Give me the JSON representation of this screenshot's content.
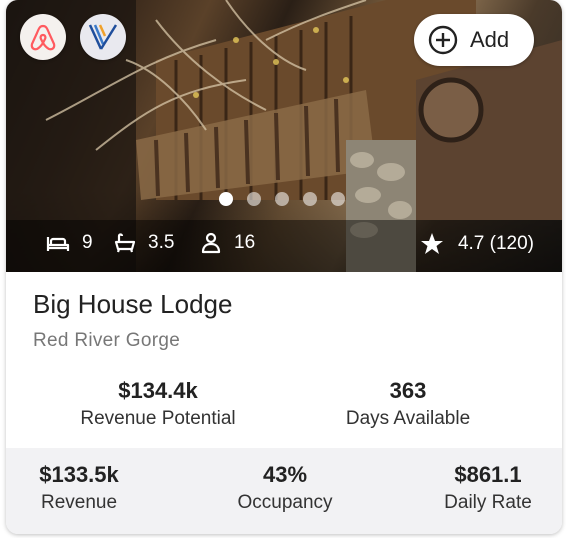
{
  "listing": {
    "title": "Big House Lodge",
    "location": "Red River Gorge",
    "add_label": "Add",
    "beds": "9",
    "baths": "3.5",
    "guests": "16",
    "rating": "4.7 (120)",
    "photo_count": 5,
    "active_photo": 1
  },
  "brands": {
    "airbnb_icon": "airbnb-logo-icon",
    "vrbo_icon": "vrbo-logo-icon",
    "airbnb_color": "#FF5A5F",
    "vrbo_color": "#1F4E9C"
  },
  "metrics": {
    "revenue_potential": {
      "value": "$134.4k",
      "label": "Revenue Potential"
    },
    "days_available": {
      "value": "363",
      "label": "Days Available"
    },
    "revenue": {
      "value": "$133.5k",
      "label": "Revenue"
    },
    "occupancy": {
      "value": "43%",
      "label": "Occupancy"
    },
    "daily_rate": {
      "value": "$861.1",
      "label": "Daily Rate"
    }
  }
}
